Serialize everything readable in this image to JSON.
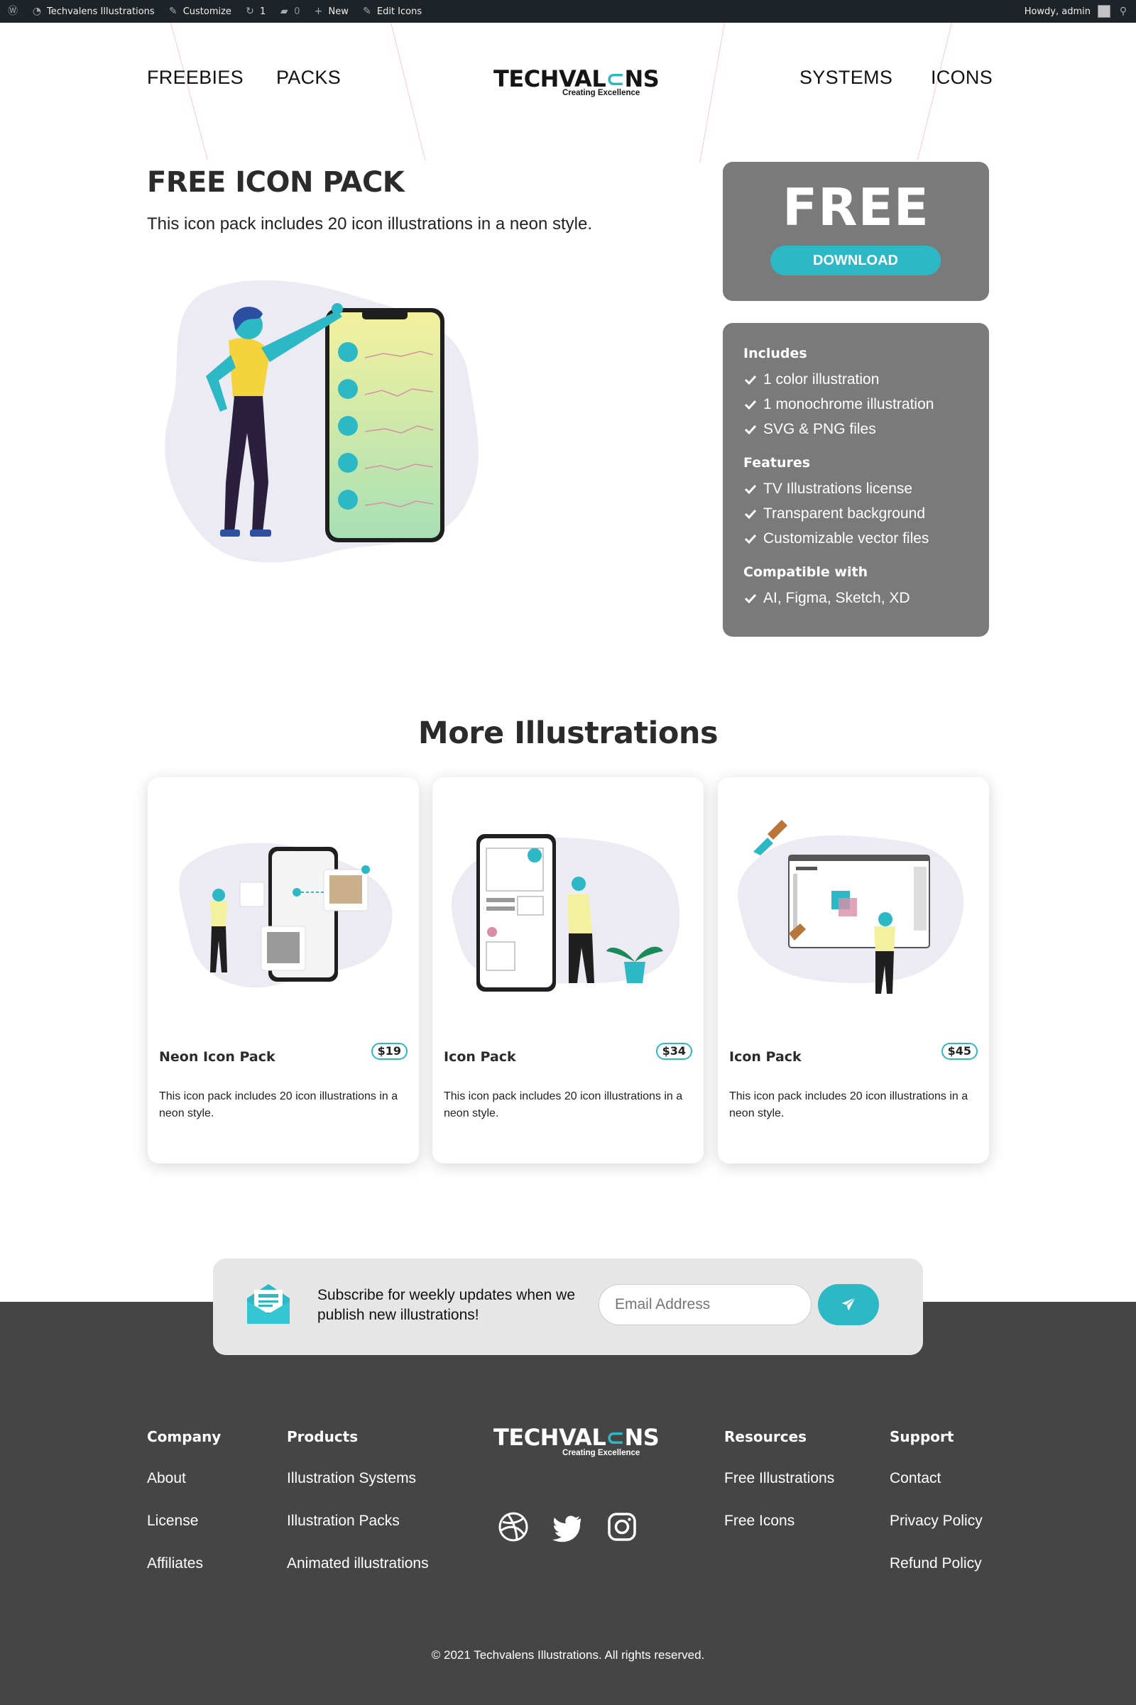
{
  "adminbar": {
    "site_name": "Techvalens Illustrations",
    "customize": "Customize",
    "updates_count": "1",
    "comments_count": "0",
    "new_label": "New",
    "edit_label": "Edit Icons",
    "howdy": "Howdy, admin"
  },
  "header": {
    "nav_left": [
      "FREEBIES",
      "PACKS"
    ],
    "nav_right": [
      "SYSTEMS",
      "ICONS"
    ],
    "logo_part1": "TECHVAL",
    "logo_part2": "NS",
    "logo_tagline": "Creating Excellence"
  },
  "hero": {
    "title": "FREE ICON PACK",
    "subtitle": "This icon pack includes 20 icon illustrations in a neon style.",
    "price_word": "FREE",
    "download_label": "DOWNLOAD"
  },
  "details": {
    "includes_heading": "Includes",
    "includes": [
      "1 color illustration",
      "1 monochrome illustration",
      "SVG & PNG files"
    ],
    "features_heading": "Features",
    "features": [
      "TV Illustrations license",
      "Transparent background",
      "Customizable vector files"
    ],
    "compatible_heading": "Compatible with",
    "compatible": [
      "AI, Figma, Sketch, XD"
    ]
  },
  "more": {
    "title": "More Illustrations",
    "cards": [
      {
        "title": "Neon Icon Pack",
        "price": "$19",
        "desc": "This icon pack includes 20 icon illustrations in a neon style."
      },
      {
        "title": "Icon Pack",
        "price": "$34",
        "desc": "This icon pack includes 20 icon illustrations in a neon style."
      },
      {
        "title": "Icon Pack",
        "price": "$45",
        "desc": "This icon pack includes 20 icon illustrations in a neon style."
      }
    ]
  },
  "subscribe": {
    "text": "Subscribe for weekly updates when we publish new illustrations!",
    "email_placeholder": "Email Address"
  },
  "footer": {
    "company": {
      "heading": "Company",
      "links": [
        "About",
        "License",
        "Affiliates"
      ]
    },
    "products": {
      "heading": "Products",
      "links": [
        "Illustration Systems",
        "Illustration Packs",
        "Animated illustrations"
      ]
    },
    "resources": {
      "heading": "Resources",
      "links": [
        "Free Illustrations",
        "Free Icons"
      ]
    },
    "support": {
      "heading": "Support",
      "links": [
        "Contact",
        "Privacy Policy",
        "Refund Policy"
      ]
    },
    "logo_part1": "TECHVAL",
    "logo_part2": "NS",
    "logo_tagline": "Creating Excellence",
    "social_icons": [
      "dribbble-icon",
      "twitter-icon",
      "instagram-icon"
    ],
    "copyright": "© 2021 Techvalens Illustrations. All rights reserved."
  },
  "colors": {
    "accent": "#2cb8c5",
    "panel": "#7a7a7a",
    "footer": "#454545"
  }
}
